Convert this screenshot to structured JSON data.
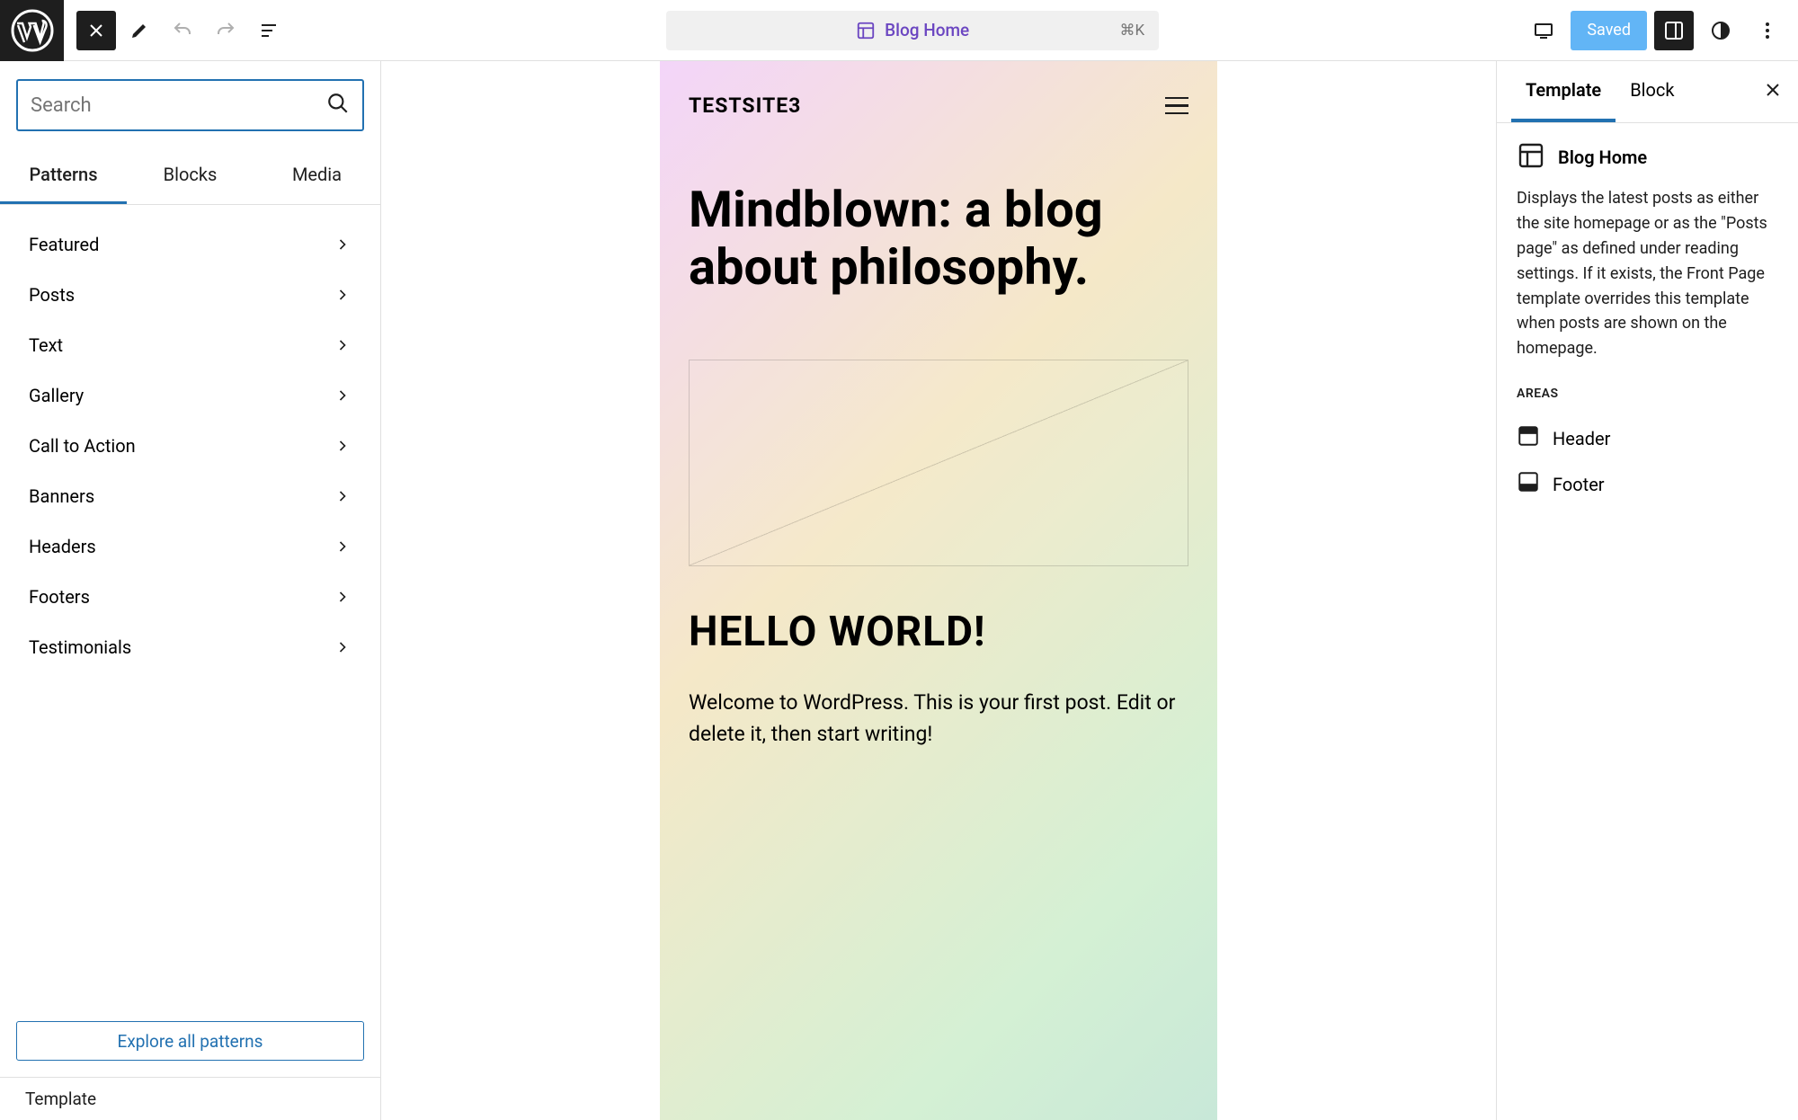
{
  "topbar": {
    "command_title": "Blog Home",
    "shortcut": "⌘K",
    "saved_label": "Saved"
  },
  "inserter": {
    "search_placeholder": "Search",
    "tabs": [
      "Patterns",
      "Blocks",
      "Media"
    ],
    "categories": [
      "Featured",
      "Posts",
      "Text",
      "Gallery",
      "Call to Action",
      "Banners",
      "Headers",
      "Footers",
      "Testimonials"
    ],
    "explore_label": "Explore all patterns",
    "footer_crumb": "Template"
  },
  "canvas": {
    "site_title": "TESTSITE3",
    "hero": "Mindblown: a blog about philosophy.",
    "post_title": "HELLO WORLD!",
    "post_body": "Welcome to WordPress. This is your first post. Edit or delete it, then start writing!"
  },
  "settings": {
    "tabs": [
      "Template",
      "Block"
    ],
    "template_name": "Blog Home",
    "template_desc": "Displays the latest posts as either the site homepage or as the \"Posts page\" as defined under reading settings. If it exists, the Front Page template overrides this template when posts are shown on the homepage.",
    "areas_label": "AREAS",
    "areas": [
      "Header",
      "Footer"
    ]
  }
}
